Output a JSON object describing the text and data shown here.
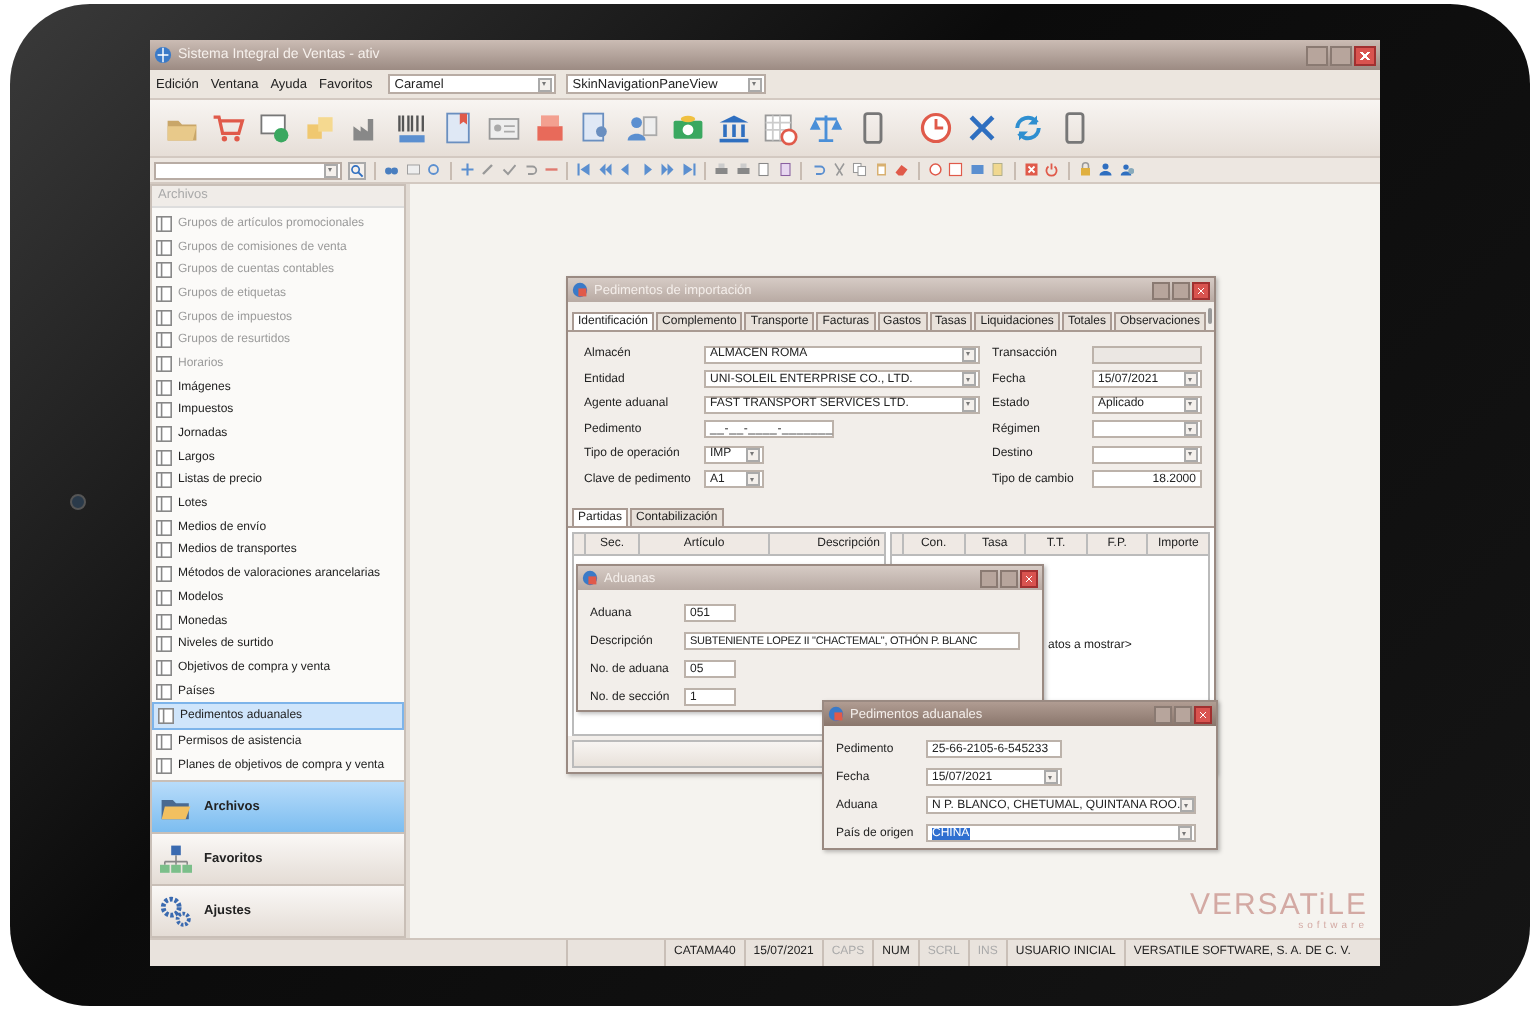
{
  "window": {
    "title": "Sistema Integral de Ventas - ativ"
  },
  "menu": [
    "Edición",
    "Ventana",
    "Ayuda",
    "Favoritos"
  ],
  "skin_combo": {
    "value": "Caramel"
  },
  "view_combo": {
    "value": "SkinNavigationPaneView"
  },
  "sidebar": {
    "header": "Archivos",
    "items": [
      {
        "label": "Grupos de artículos promocionales",
        "disabled": true,
        "selected": false
      },
      {
        "label": "Grupos de comisiones de venta",
        "disabled": true,
        "selected": false
      },
      {
        "label": "Grupos de cuentas contables",
        "disabled": true,
        "selected": false
      },
      {
        "label": "Grupos de etiquetas",
        "disabled": true,
        "selected": false
      },
      {
        "label": "Grupos de impuestos",
        "disabled": true,
        "selected": false
      },
      {
        "label": "Grupos de resurtidos",
        "disabled": true,
        "selected": false
      },
      {
        "label": "Horarios",
        "disabled": true,
        "selected": false
      },
      {
        "label": "Imágenes",
        "disabled": false,
        "selected": false
      },
      {
        "label": "Impuestos",
        "disabled": false,
        "selected": false
      },
      {
        "label": "Jornadas",
        "disabled": false,
        "selected": false
      },
      {
        "label": "Largos",
        "disabled": false,
        "selected": false
      },
      {
        "label": "Listas de precio",
        "disabled": false,
        "selected": false
      },
      {
        "label": "Lotes",
        "disabled": false,
        "selected": false
      },
      {
        "label": "Medios de envío",
        "disabled": false,
        "selected": false
      },
      {
        "label": "Medios de transportes",
        "disabled": false,
        "selected": false
      },
      {
        "label": "Métodos de valoraciones arancelarias",
        "disabled": false,
        "selected": false
      },
      {
        "label": "Modelos",
        "disabled": false,
        "selected": false
      },
      {
        "label": "Monedas",
        "disabled": false,
        "selected": false
      },
      {
        "label": "Niveles de surtido",
        "disabled": false,
        "selected": false
      },
      {
        "label": "Objetivos de compra y venta",
        "disabled": false,
        "selected": false
      },
      {
        "label": "Países",
        "disabled": false,
        "selected": false
      },
      {
        "label": "Pedimentos aduanales",
        "disabled": false,
        "selected": true
      },
      {
        "label": "Permisos de asistencia",
        "disabled": false,
        "selected": false
      },
      {
        "label": "Planes de objetivos de compra y venta",
        "disabled": false,
        "selected": false
      }
    ],
    "nav": [
      {
        "label": "Archivos",
        "selected": true,
        "kind": "folder"
      },
      {
        "label": "Favoritos",
        "selected": false,
        "kind": "tree"
      },
      {
        "label": "Ajustes",
        "selected": false,
        "kind": "gears"
      }
    ]
  },
  "import_dialog": {
    "title": "Pedimentos de importación",
    "active": false,
    "tabs": [
      {
        "label": "Identificación",
        "selected": true
      },
      {
        "label": "Complemento",
        "selected": false
      },
      {
        "label": "Transporte",
        "selected": false
      },
      {
        "label": "Facturas",
        "selected": false
      },
      {
        "label": "Gastos",
        "selected": false
      },
      {
        "label": "Tasas",
        "selected": false
      },
      {
        "label": "Liquidaciones",
        "selected": false
      },
      {
        "label": "Totales",
        "selected": false
      },
      {
        "label": "Observaciones",
        "selected": false
      }
    ],
    "fields_left": [
      {
        "label": "Almacén",
        "value": "ALMACEN ROMA",
        "kind": "combo"
      },
      {
        "label": "Entidad",
        "value": "UNI-SOLEIL ENTERPRISE CO., LTD.",
        "kind": "combo"
      },
      {
        "label": "Agente aduanal",
        "value": "FAST TRANSPORT SERVICES LTD.",
        "kind": "combo"
      },
      {
        "label": "Pedimento",
        "value": "__-__-____-_______",
        "kind": "mask"
      },
      {
        "label": "Tipo de operación",
        "value": "IMP",
        "kind": "small-combo"
      },
      {
        "label": "Clave de pedimento",
        "value": "A1",
        "kind": "small-combo"
      }
    ],
    "fields_right": [
      {
        "label": "Transacción",
        "kind": "readonly"
      },
      {
        "label": "Fecha",
        "value": "15/07/2021",
        "kind": "combo"
      },
      {
        "label": "Estado",
        "value": "Aplicado",
        "kind": "combo"
      },
      {
        "label": "Régimen",
        "kind": "combo"
      },
      {
        "label": "Destino",
        "kind": "combo"
      },
      {
        "label": "Tipo de cambio",
        "value": "18.2000",
        "kind": "number"
      }
    ],
    "subtabs": [
      {
        "label": "Partidas",
        "selected": true
      },
      {
        "label": "Contabilización",
        "selected": false
      }
    ],
    "grid_left_columns": [
      "Sec.",
      "Artículo",
      "Descripción"
    ],
    "grid_right_columns": [
      "Con.",
      "Tasa",
      "T.T.",
      "F.P.",
      "Importe"
    ],
    "empty_message": "atos a mostrar>"
  },
  "customs_dialog": {
    "title": "Aduanas",
    "active": false,
    "fields": [
      {
        "label": "Aduana",
        "value": "051",
        "kind": "short"
      },
      {
        "label": "Descripción",
        "value": "SUBTENIENTE LOPEZ II \"CHACTEMAL\", OTHÓN P. BLANC",
        "kind": "long"
      },
      {
        "label": "No. de aduana",
        "value": "05",
        "kind": "short"
      },
      {
        "label": "No. de sección",
        "value": "1",
        "kind": "short"
      }
    ]
  },
  "entries_dialog": {
    "title": "Pedimentos aduanales",
    "active": true,
    "fields": [
      {
        "label": "Pedimento",
        "value": "25-66-2105-6-545233",
        "kind": "text",
        "highlighted": false
      },
      {
        "label": "Fecha",
        "value": "15/07/2021",
        "kind": "date",
        "highlighted": false
      },
      {
        "label": "Aduana",
        "value": "N P. BLANCO, CHETUMAL, QUINTANA ROO.",
        "kind": "combo",
        "highlighted": false
      },
      {
        "label": "País de origen",
        "value": "CHINA",
        "kind": "combo",
        "highlighted": true
      }
    ]
  },
  "logo": {
    "name": "VERSATiLE",
    "tagline": "software"
  },
  "status_bar": [
    {
      "text": "CATAMA40",
      "on": true
    },
    {
      "text": "15/07/2021",
      "on": true
    },
    {
      "text": "CAPS",
      "on": false
    },
    {
      "text": "NUM",
      "on": true
    },
    {
      "text": "SCRL",
      "on": false
    },
    {
      "text": "INS",
      "on": false
    },
    {
      "text": "USUARIO INICIAL",
      "on": true
    },
    {
      "text": "VERSATILE SOFTWARE, S. A. DE C. V.",
      "on": true
    }
  ]
}
